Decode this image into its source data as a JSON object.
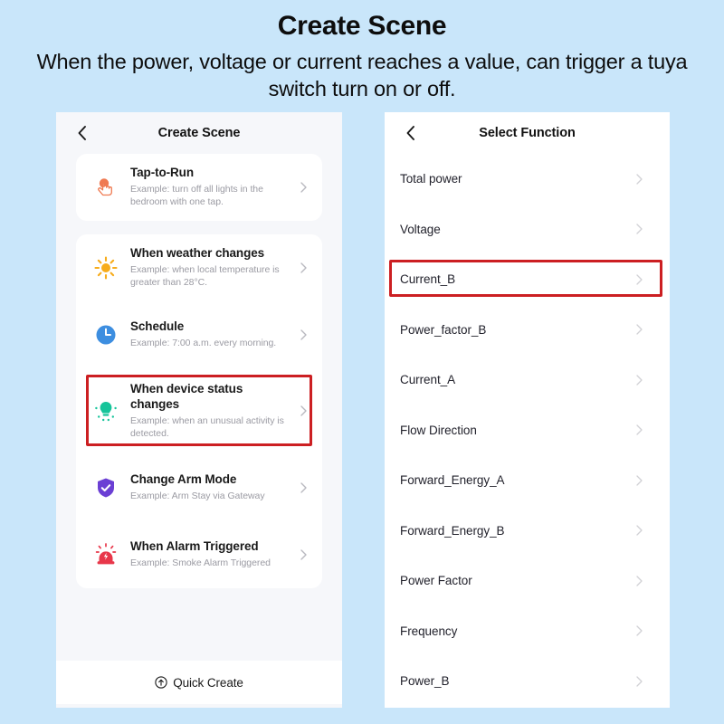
{
  "header": {
    "title": "Create Scene",
    "subtitle": "When the power, voltage or current reaches a value, can trigger a tuya switch turn on or off."
  },
  "colors": {
    "page_background": "#c9e6fa",
    "panel_background": "#f6f7fa",
    "card_background": "#ffffff",
    "highlight_red": "#cc1f22",
    "title_text": "#1a1a1a",
    "muted_text": "#9b9ba3",
    "icon_tap": "#e8734a",
    "icon_weather": "#f5a623",
    "icon_schedule": "#4a90e2",
    "icon_device": "#18c39a",
    "icon_arm": "#6b3fd4",
    "icon_alarm": "#e8374a"
  },
  "left_panel": {
    "nav": {
      "back_icon": "chevron-left-icon",
      "title": "Create Scene"
    },
    "scenes": [
      {
        "icon": "tap-to-run-icon",
        "title": "Tap-to-Run",
        "desc": "Example: turn off all lights in the bedroom with one tap.",
        "chevron": "chevron-right-icon",
        "highlighted": false
      },
      {
        "icon": "sun-weather-icon",
        "title": "When weather changes",
        "desc": "Example: when local temperature is greater than 28°C.",
        "chevron": "chevron-right-icon",
        "highlighted": false
      },
      {
        "icon": "clock-schedule-icon",
        "title": "Schedule",
        "desc": "Example: 7:00 a.m. every morning.",
        "chevron": "chevron-right-icon",
        "highlighted": false
      },
      {
        "icon": "device-status-icon",
        "title": "When device status changes",
        "desc": "Example: when an unusual activity is detected.",
        "chevron": "chevron-right-icon",
        "highlighted": true
      },
      {
        "icon": "shield-check-icon",
        "title": "Change Arm Mode",
        "desc": "Example: Arm Stay via Gateway",
        "chevron": "chevron-right-icon",
        "highlighted": false
      },
      {
        "icon": "alarm-siren-icon",
        "title": "When Alarm Triggered",
        "desc": "Example: Smoke Alarm Triggered",
        "chevron": "chevron-right-icon",
        "highlighted": false
      }
    ],
    "quick_create": {
      "icon": "arrow-up-circle-icon",
      "label": "Quick Create"
    }
  },
  "right_panel": {
    "nav": {
      "back_icon": "chevron-left-icon",
      "title": "Select Function"
    },
    "functions": [
      {
        "label": "Total power",
        "chevron": "chevron-right-icon",
        "highlighted": false
      },
      {
        "label": "Voltage",
        "chevron": "chevron-right-icon",
        "highlighted": false
      },
      {
        "label": "Current_B",
        "chevron": "chevron-right-icon",
        "highlighted": true
      },
      {
        "label": "Power_factor_B",
        "chevron": "chevron-right-icon",
        "highlighted": false
      },
      {
        "label": "Current_A",
        "chevron": "chevron-right-icon",
        "highlighted": false
      },
      {
        "label": "Flow Direction",
        "chevron": "chevron-right-icon",
        "highlighted": false
      },
      {
        "label": "Forward_Energy_A",
        "chevron": "chevron-right-icon",
        "highlighted": false
      },
      {
        "label": "Forward_Energy_B",
        "chevron": "chevron-right-icon",
        "highlighted": false
      },
      {
        "label": "Power Factor",
        "chevron": "chevron-right-icon",
        "highlighted": false
      },
      {
        "label": "Frequency",
        "chevron": "chevron-right-icon",
        "highlighted": false
      },
      {
        "label": "Power_B",
        "chevron": "chevron-right-icon",
        "highlighted": false
      }
    ]
  }
}
